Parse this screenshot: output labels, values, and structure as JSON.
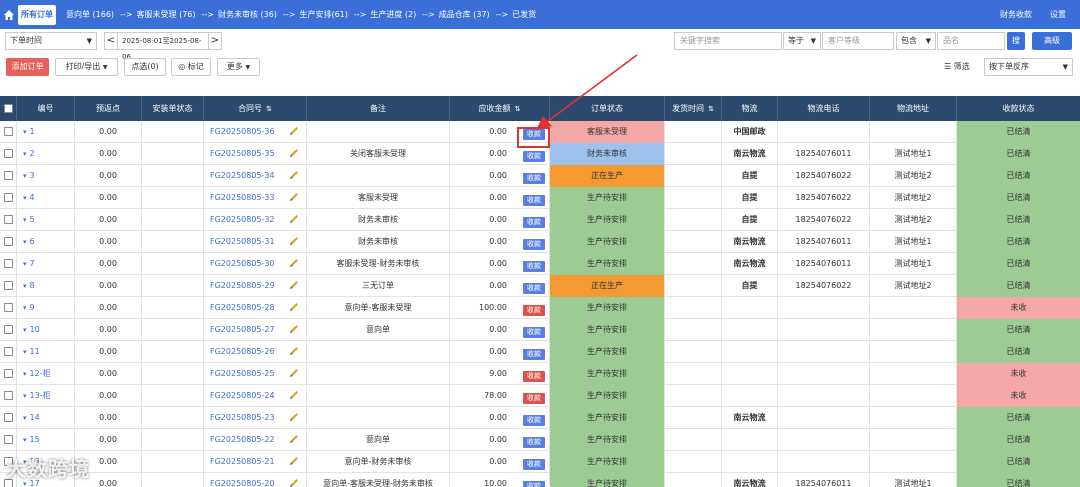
{
  "topnav": {
    "active_tab": "所有订单",
    "items": [
      {
        "label": "意向单 (166)"
      },
      {
        "label": "客服未受理 (76)"
      },
      {
        "label": "财务未审核 (36)"
      },
      {
        "label": "生产安排(61)"
      },
      {
        "label": "生产进度 (2)"
      },
      {
        "label": "成品仓库 (37)"
      },
      {
        "label": "已发货"
      }
    ],
    "arrow": "-->",
    "right_items": [
      "财务收款",
      "设置"
    ]
  },
  "filters": {
    "time_select": "下单时间",
    "date_range": "2025-08-01至2025-08-06",
    "prev": "<",
    "next": ">",
    "keyword_placeholder": "关键字搜索",
    "op1": "等于",
    "level_placeholder": "客户等级",
    "op2": "包含",
    "name_placeholder": "品名",
    "search_btn": "搜",
    "advanced_btn": "高级"
  },
  "actions": {
    "add_order": "添加订单",
    "print_export": "打印/导出",
    "pick": "点选(0)",
    "mark": "标记",
    "more": "更多",
    "filter": "筛选",
    "sort": "按下单反序"
  },
  "table": {
    "headers": {
      "no": "编号",
      "prepay": "预返点",
      "install": "安装单状态",
      "contract": "合同号",
      "remark": "备注",
      "amount": "应收金额",
      "status": "订单状态",
      "ship_time": "发货时间",
      "logistics": "物流",
      "phone": "物流电话",
      "address": "物流地址",
      "pay_status": "收款状态"
    },
    "pay_label": "收款",
    "rows": [
      {
        "no": "1",
        "prepay": "0.00",
        "contract": "FG20250805-36",
        "remark": "",
        "amount": "0.00",
        "pay_btn": "blue",
        "status": "客服未受理",
        "status_color": "#f4a7a7",
        "logistics": "中国邮政",
        "phone": "",
        "address": "",
        "pay_status": "已结清",
        "pay_color": "#9ccc94"
      },
      {
        "no": "2",
        "prepay": "0.00",
        "contract": "FG20250805-35",
        "remark": "关闭客服未受理",
        "amount": "0.00",
        "pay_btn": "blue",
        "status": "财务未审核",
        "status_color": "#9dc3ec",
        "logistics": "南云物流",
        "phone": "18254076011",
        "address": "测试地址1",
        "pay_status": "已结清",
        "pay_color": "#9ccc94"
      },
      {
        "no": "3",
        "prepay": "0.00",
        "contract": "FG20250805-34",
        "remark": "",
        "amount": "0.00",
        "pay_btn": "blue",
        "status": "正在生产",
        "status_color": "#f59a33",
        "logistics": "自提",
        "phone": "18254076022",
        "address": "测试地址2",
        "pay_status": "已结清",
        "pay_color": "#9ccc94"
      },
      {
        "no": "4",
        "prepay": "0.00",
        "contract": "FG20250805-33",
        "remark": "客服未受理",
        "amount": "0.00",
        "pay_btn": "blue",
        "status": "生产待安排",
        "status_color": "#9ccc94",
        "logistics": "自提",
        "phone": "18254076022",
        "address": "测试地址2",
        "pay_status": "已结清",
        "pay_color": "#9ccc94"
      },
      {
        "no": "5",
        "prepay": "0.00",
        "contract": "FG20250805-32",
        "remark": "财务未审核",
        "amount": "0.00",
        "pay_btn": "blue",
        "status": "生产待安排",
        "status_color": "#9ccc94",
        "logistics": "自提",
        "phone": "18254076022",
        "address": "测试地址2",
        "pay_status": "已结清",
        "pay_color": "#9ccc94"
      },
      {
        "no": "6",
        "prepay": "0.00",
        "contract": "FG20250805-31",
        "remark": "财务未审核",
        "amount": "0.00",
        "pay_btn": "blue",
        "status": "生产待安排",
        "status_color": "#9ccc94",
        "logistics": "南云物流",
        "phone": "18254076011",
        "address": "测试地址1",
        "pay_status": "已结清",
        "pay_color": "#9ccc94"
      },
      {
        "no": "7",
        "prepay": "0.00",
        "contract": "FG20250805-30",
        "remark": "客服未受理-财务未审核",
        "amount": "0.00",
        "pay_btn": "blue",
        "status": "生产待安排",
        "status_color": "#9ccc94",
        "logistics": "南云物流",
        "phone": "18254076011",
        "address": "测试地址1",
        "pay_status": "已结清",
        "pay_color": "#9ccc94"
      },
      {
        "no": "8",
        "prepay": "0.00",
        "contract": "FG20250805-29",
        "remark": "三无订单",
        "amount": "0.00",
        "pay_btn": "blue",
        "status": "正在生产",
        "status_color": "#f59a33",
        "logistics": "自提",
        "phone": "18254076022",
        "address": "测试地址2",
        "pay_status": "已结清",
        "pay_color": "#9ccc94"
      },
      {
        "no": "9",
        "prepay": "0.00",
        "contract": "FG20250805-28",
        "remark": "意向单-客服未受理",
        "amount": "100.00",
        "pay_btn": "red",
        "status": "生产待安排",
        "status_color": "#9ccc94",
        "logistics": "",
        "phone": "",
        "address": "",
        "pay_status": "未收",
        "pay_color": "#f4a7a7"
      },
      {
        "no": "10",
        "prepay": "0.00",
        "contract": "FG20250805-27",
        "remark": "意向单",
        "amount": "0.00",
        "pay_btn": "blue",
        "status": "生产待安排",
        "status_color": "#9ccc94",
        "logistics": "",
        "phone": "",
        "address": "",
        "pay_status": "已结清",
        "pay_color": "#9ccc94"
      },
      {
        "no": "11",
        "prepay": "0.00",
        "contract": "FG20250805-26",
        "remark": "",
        "amount": "0.00",
        "pay_btn": "blue",
        "status": "生产待安排",
        "status_color": "#9ccc94",
        "logistics": "",
        "phone": "",
        "address": "",
        "pay_status": "已结清",
        "pay_color": "#9ccc94"
      },
      {
        "no": "12-柜",
        "prepay": "0.00",
        "contract": "FG20250805-25",
        "remark": "",
        "amount": "9.00",
        "pay_btn": "red",
        "status": "生产待安排",
        "status_color": "#9ccc94",
        "logistics": "",
        "phone": "",
        "address": "",
        "pay_status": "未收",
        "pay_color": "#f4a7a7"
      },
      {
        "no": "13-柜",
        "prepay": "0.00",
        "contract": "FG20250805-24",
        "remark": "",
        "amount": "78.00",
        "pay_btn": "red",
        "status": "生产待安排",
        "status_color": "#9ccc94",
        "logistics": "",
        "phone": "",
        "address": "",
        "pay_status": "未收",
        "pay_color": "#f4a7a7"
      },
      {
        "no": "14",
        "prepay": "0.00",
        "contract": "FG20250805-23",
        "remark": "",
        "amount": "0.00",
        "pay_btn": "blue",
        "status": "生产待安排",
        "status_color": "#9ccc94",
        "logistics": "南云物流",
        "phone": "",
        "address": "",
        "pay_status": "已结清",
        "pay_color": "#9ccc94"
      },
      {
        "no": "15",
        "prepay": "0.00",
        "contract": "FG20250805-22",
        "remark": "意向单",
        "amount": "0.00",
        "pay_btn": "blue",
        "status": "生产待安排",
        "status_color": "#9ccc94",
        "logistics": "",
        "phone": "",
        "address": "",
        "pay_status": "已结清",
        "pay_color": "#9ccc94"
      },
      {
        "no": "16",
        "prepay": "0.00",
        "contract": "FG20250805-21",
        "remark": "意向单-财务未审核",
        "amount": "0.00",
        "pay_btn": "blue",
        "status": "生产待安排",
        "status_color": "#9ccc94",
        "logistics": "",
        "phone": "",
        "address": "",
        "pay_status": "已结清",
        "pay_color": "#9ccc94"
      },
      {
        "no": "17",
        "prepay": "0.00",
        "contract": "FG20250805-20",
        "remark": "意向单-客服未受理-财务未审核",
        "amount": "10.00",
        "pay_btn": "blue",
        "status": "生产待安排",
        "status_color": "#9ccc94",
        "logistics": "南云物流",
        "phone": "18254076011",
        "address": "测试地址1",
        "pay_status": "已结清",
        "pay_color": "#9ccc94"
      }
    ]
  },
  "colors": {
    "brand": "#3b6fd8",
    "header_bg": "#2c4a6e",
    "pay_blue": "#5b7fe0",
    "pay_red": "#d9534f",
    "annotation": "#e23131"
  },
  "watermark": "大数跨境"
}
